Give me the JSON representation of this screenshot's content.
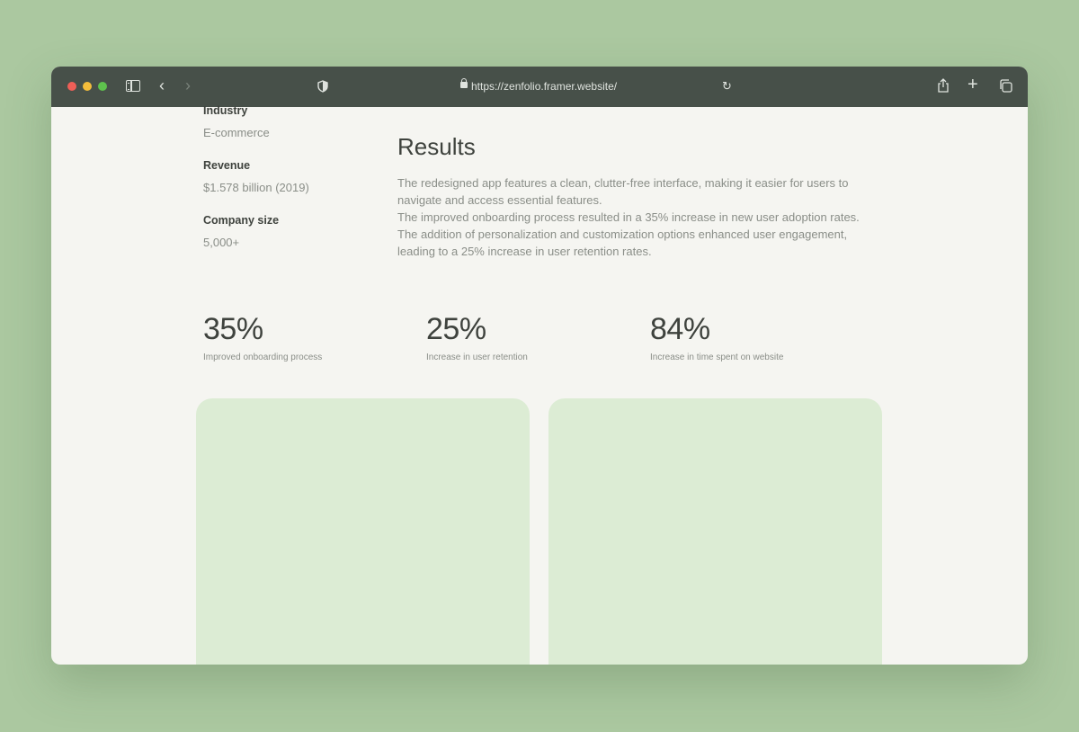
{
  "browser": {
    "url": "https://zenfolio.framer.website/",
    "icons": [
      "sidebar-icon",
      "back-icon",
      "forward-icon",
      "shield-icon",
      "lock-icon",
      "reload-icon",
      "share-icon",
      "plus-icon",
      "tabs-icon"
    ]
  },
  "meta": {
    "industry_label": "Industry",
    "industry_value": "E-commerce",
    "revenue_label": "Revenue",
    "revenue_value": "$1.578 billion (2019)",
    "company_size_label": "Company size",
    "company_size_value": "5,000+"
  },
  "results": {
    "title": "Results",
    "paragraphs": [
      "The redesigned app features a clean, clutter-free interface, making it easier for users to navigate and access essential features.",
      "The improved onboarding process resulted in a 35% increase in new user adoption rates.",
      "The addition of personalization and customization options enhanced user engagement, leading to a 25% increase in user retention rates."
    ]
  },
  "stats": [
    {
      "value": "35%",
      "label": "Improved onboarding process"
    },
    {
      "value": "25%",
      "label": "Increase in user retention"
    },
    {
      "value": "84%",
      "label": "Increase in time spent on website"
    }
  ],
  "colors": {
    "background": "#abc8a0",
    "toolbar": "#475049",
    "page": "#f5f5f1",
    "card": "#dcecd4",
    "text_dark": "#3e423d",
    "text_muted": "#8a8e88"
  }
}
